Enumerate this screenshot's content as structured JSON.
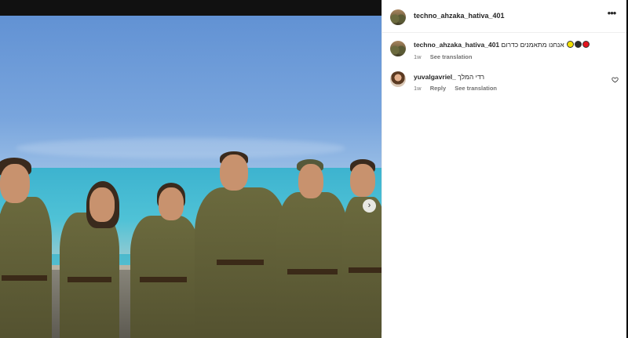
{
  "post": {
    "author": "techno_ahzaka_hativa_401",
    "more_icon": "more-horizontal-icon",
    "next_icon": "chevron-right-icon",
    "next_glyph": "›",
    "more_glyph": "•••"
  },
  "caption": {
    "username": "techno_ahzaka_hativa_401",
    "text": "אנחנו מתאמנים כדרום",
    "dots": [
      {
        "color": "#f4e100"
      },
      {
        "color": "#2b2b2b"
      },
      {
        "color": "#e3141e"
      }
    ],
    "age": "1w",
    "see_translation": "See translation"
  },
  "comments": [
    {
      "username": "yuvalgavriel_",
      "text": "רדי המלך",
      "age": "1w",
      "reply": "Reply",
      "see_translation": "See translation",
      "like_icon": "heart-outline-icon"
    }
  ]
}
